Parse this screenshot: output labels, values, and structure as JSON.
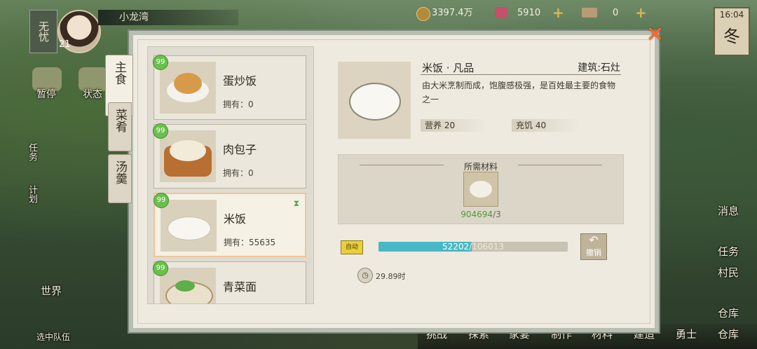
{
  "player": {
    "name": "小龙湾",
    "level": "21",
    "status": "无忧"
  },
  "resources": {
    "coins": "3397.4万",
    "gems": "5910",
    "tickets": "0"
  },
  "clock": {
    "time": "16:04",
    "season": "冬"
  },
  "left_menu": [
    "暂停",
    "状态",
    "任务",
    "计划",
    "世界",
    "选中队伍"
  ],
  "right_menu": [
    "消息",
    "任务",
    "村民",
    "仓库"
  ],
  "bottom_nav": [
    "挑战",
    "探索",
    "家宴",
    "制作",
    "材料",
    "建造",
    "勇士",
    "仓库"
  ],
  "tabs": [
    {
      "label": "主食"
    },
    {
      "label": "菜肴"
    },
    {
      "label": "汤羹"
    }
  ],
  "recipes": [
    {
      "name": "蛋炒饭",
      "owned": "拥有：0",
      "badge": "99"
    },
    {
      "name": "肉包子",
      "owned": "拥有：0",
      "badge": "99"
    },
    {
      "name": "米饭",
      "owned": "拥有：55635",
      "badge": "99",
      "hourglass": "⧗"
    },
    {
      "name": "青菜面",
      "owned": "",
      "badge": "99"
    }
  ],
  "detail": {
    "title": "米饭 · 凡品",
    "building": "建筑:石灶",
    "description": "由大米烹制而成，饱腹感极强，是百姓最主要的食物之一",
    "nutrition": "营养 20",
    "satiety": "充饥 40",
    "materials_label": "所需材料",
    "material_have": "904694",
    "material_need": "/3",
    "auto_label": "自动",
    "progress_current": "52202",
    "progress_total": "/106013",
    "progress_fraction": 0.4924,
    "cancel_label": "撤销",
    "timer": "29.89时"
  }
}
